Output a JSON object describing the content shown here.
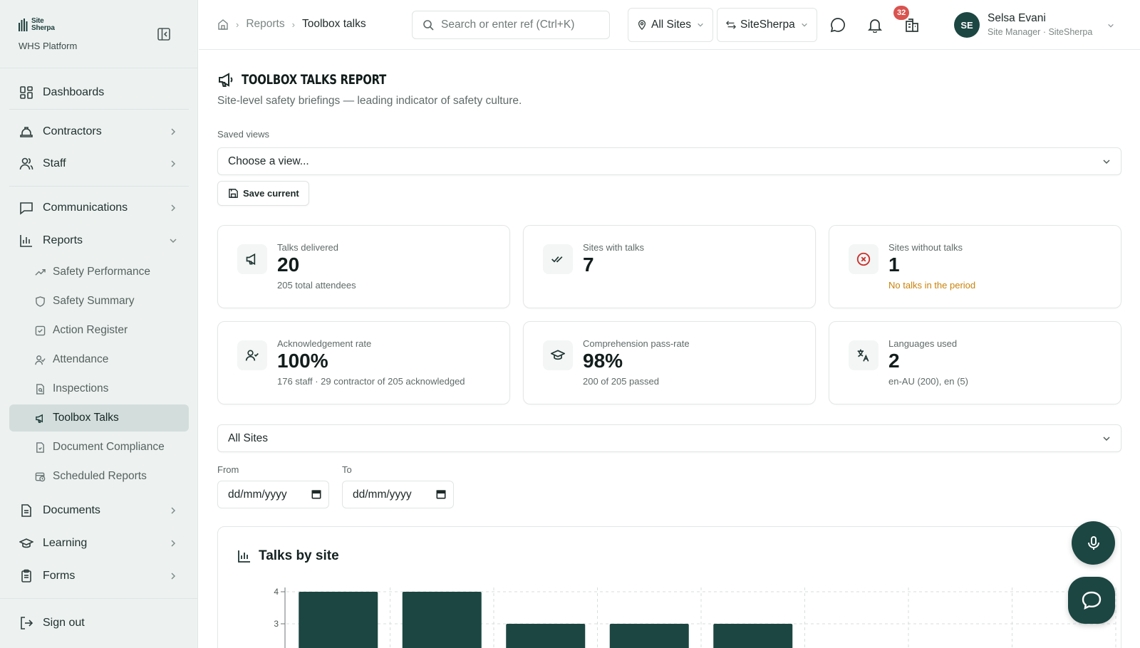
{
  "brand": {
    "logo_line1": "Site",
    "logo_line2": "Sherpa",
    "subtitle": "WHS Platform"
  },
  "sidebar": {
    "items": [
      {
        "label": "Dashboards",
        "icon": "dashboard-icon"
      },
      {
        "label": "Contractors",
        "icon": "hard-hat-icon"
      },
      {
        "label": "Staff",
        "icon": "users-icon"
      },
      {
        "label": "Communications",
        "icon": "message-icon"
      },
      {
        "label": "Reports",
        "icon": "bar-chart-icon"
      },
      {
        "label": "Documents",
        "icon": "document-icon"
      },
      {
        "label": "Learning",
        "icon": "graduation-cap-icon"
      },
      {
        "label": "Forms",
        "icon": "clipboard-icon"
      }
    ],
    "report_subitems": [
      {
        "label": "Safety Performance",
        "icon": "trend-up-icon"
      },
      {
        "label": "Safety Summary",
        "icon": "shield-icon"
      },
      {
        "label": "Action Register",
        "icon": "check-square-icon"
      },
      {
        "label": "Attendance",
        "icon": "user-check-icon"
      },
      {
        "label": "Inspections",
        "icon": "file-search-icon"
      },
      {
        "label": "Toolbox Talks",
        "icon": "megaphone-icon",
        "active": true
      },
      {
        "label": "Document Compliance",
        "icon": "file-check-icon"
      },
      {
        "label": "Scheduled Reports",
        "icon": "calendar-clock-icon"
      }
    ],
    "sign_out": "Sign out"
  },
  "header": {
    "breadcrumb": [
      "Reports",
      "Toolbox talks"
    ],
    "search_placeholder": "Search or enter ref (Ctrl+K)",
    "site_filter": "All Sites",
    "org_switch": "SiteSherpa",
    "notification_count": "32",
    "user": {
      "initials": "SE",
      "name": "Selsa Evani",
      "role": "Site Manager · SiteSherpa"
    }
  },
  "page": {
    "title": "TOOLBOX TALKS REPORT",
    "subtitle": "Site-level safety briefings — leading indicator of safety culture.",
    "saved_views_label": "Saved views",
    "saved_views_placeholder": "Choose a view...",
    "save_current": "Save current"
  },
  "cards": [
    {
      "title": "Talks delivered",
      "value": "20",
      "sub": "205 total attendees",
      "icon": "megaphone-icon"
    },
    {
      "title": "Sites with talks",
      "value": "7",
      "sub": "",
      "icon": "double-check-icon"
    },
    {
      "title": "Sites without talks",
      "value": "1",
      "sub": "No talks in the period",
      "icon": "x-circle-icon"
    },
    {
      "title": "Acknowledgement rate",
      "value": "100%",
      "sub": "176 staff · 29 contractor of 205 acknowledged",
      "icon": "user-check-icon"
    },
    {
      "title": "Comprehension pass-rate",
      "value": "98%",
      "sub": "200 of 205 passed",
      "icon": "graduation-cap-icon"
    },
    {
      "title": "Languages used",
      "value": "2",
      "sub": "en-AU (200), en (5)",
      "icon": "translate-icon"
    }
  ],
  "filters": {
    "site": "All Sites",
    "from_label": "From",
    "to_label": "To",
    "from_value": "dd/mm/yyyy",
    "to_value": "dd/mm/yyyy"
  },
  "colors": {
    "accent": "#1c4642",
    "warning": "#c9830a",
    "danger": "#d9534f"
  },
  "chart_data": {
    "type": "bar",
    "title": "Talks by site",
    "categories": [
      "",
      "",
      "",
      "",
      "",
      "",
      "",
      ""
    ],
    "values": [
      4,
      4,
      3,
      3,
      3,
      null,
      null,
      null
    ],
    "yticks": [
      3,
      4
    ],
    "grid": true
  }
}
